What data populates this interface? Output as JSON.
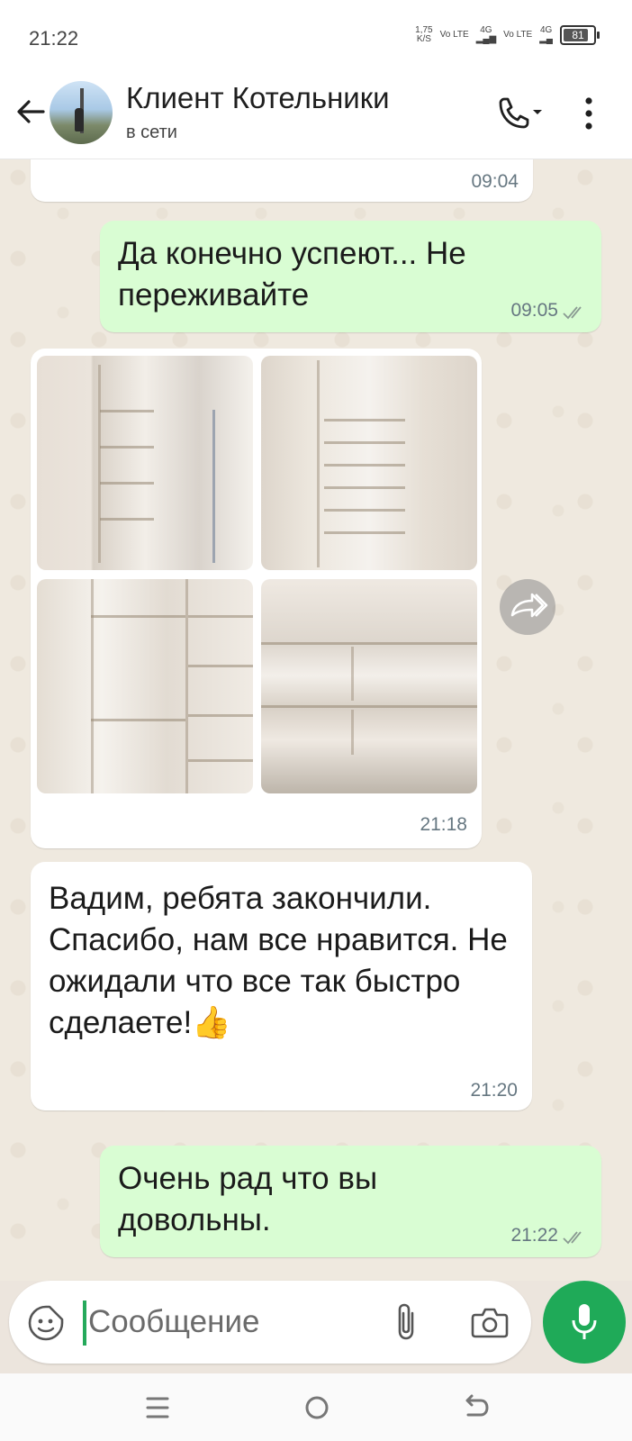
{
  "status_bar": {
    "time": "21:22",
    "net_speed": "1,75",
    "net_speed_unit": "K/S",
    "sim1_label": "Vo LTE",
    "sim1_type": "4G",
    "sim2_label": "Vo LTE",
    "sim2_type": "4G",
    "battery": "81"
  },
  "header": {
    "contact_name": "Клиент Котельники",
    "contact_status": "в сети"
  },
  "messages": [
    {
      "direction": "in",
      "text": "",
      "time": "09:04"
    },
    {
      "direction": "out",
      "text": "Да конечно успеют... Не переживайте",
      "time": "09:05"
    },
    {
      "direction": "in",
      "type": "photos",
      "time": "21:18"
    },
    {
      "direction": "in",
      "text": "Вадим, ребята закончили. Спасибо, нам все нравится. Не ожидали что все так быстро сделаете!👍",
      "time": "21:20"
    },
    {
      "direction": "out",
      "text": "Очень рад что вы довольны.",
      "time": "21:22"
    }
  ],
  "composer": {
    "placeholder": "Сообщение"
  },
  "colors": {
    "accent": "#1faa58",
    "outgoing_bubble": "#d9fdd3",
    "incoming_bubble": "#ffffff",
    "chat_background": "#efe9df"
  },
  "icons": [
    "back-arrow-icon",
    "phone-icon",
    "more-vert-icon",
    "forward-icon",
    "emoji-sticker-icon",
    "attach-icon",
    "camera-icon",
    "mic-icon",
    "nav-menu-icon",
    "nav-home-icon",
    "nav-back-icon"
  ]
}
